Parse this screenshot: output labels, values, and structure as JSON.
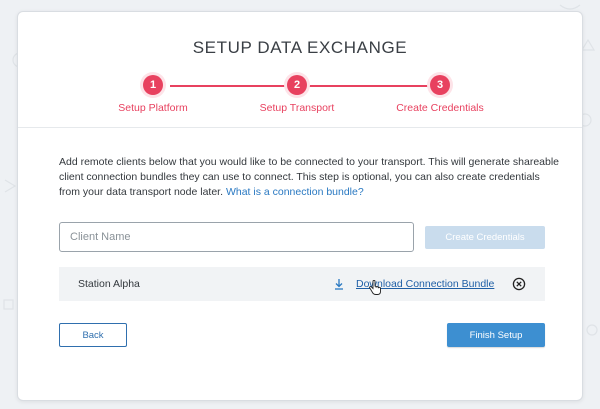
{
  "dialog": {
    "title": "SETUP DATA EXCHANGE"
  },
  "steps": [
    {
      "number": "1",
      "label": "Setup Platform"
    },
    {
      "number": "2",
      "label": "Setup Transport"
    },
    {
      "number": "3",
      "label": "Create Credentials"
    }
  ],
  "description": {
    "text": "Add remote clients below that you would like to be connected to your transport. This will generate shareable client connection bundles they can use to connect. This step is optional, you can also create credentials from your data transport node later. ",
    "link": "What is a connection bundle?"
  },
  "form": {
    "client_name_placeholder": "Client Name",
    "create_button": "Create Credentials"
  },
  "clients": [
    {
      "name": "Station Alpha",
      "download_label": "Download Connection Bundle"
    }
  ],
  "footer": {
    "back_button": "Back",
    "finish_button": "Finish Setup"
  },
  "colors": {
    "accent": "#e8415f",
    "primary": "#3d8fd1",
    "link": "#2a79c2"
  }
}
